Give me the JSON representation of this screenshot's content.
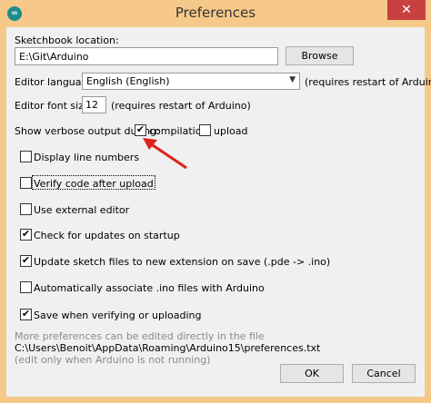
{
  "window": {
    "title": "Preferences",
    "close_glyph": "✕",
    "app_icon_text": "∞"
  },
  "sketchbook": {
    "label": "Sketchbook location:",
    "value": "E:\\Git\\Arduino",
    "browse_label": "Browse"
  },
  "language": {
    "label": "Editor language:",
    "value": "English (English)",
    "note": "(requires restart of Arduino)"
  },
  "font_size": {
    "label": "Editor font size:",
    "value": "12",
    "note": "(requires restart of Arduino)"
  },
  "verbose": {
    "label": "Show verbose output during:",
    "compilation_label": "compilation",
    "compilation_checked": true,
    "upload_label": "upload",
    "upload_checked": false
  },
  "options": [
    {
      "label": "Display line numbers",
      "checked": false
    },
    {
      "label": "Verify code after upload",
      "checked": false
    },
    {
      "label": "Use external editor",
      "checked": false
    },
    {
      "label": "Check for updates on startup",
      "checked": true
    },
    {
      "label": "Update sketch files to new extension on save (.pde -> .ino)",
      "checked": true
    },
    {
      "label": "Automatically associate .ino files with Arduino",
      "checked": false
    },
    {
      "label": "Save when verifying or uploading",
      "checked": true
    }
  ],
  "footer": {
    "more_text": "More preferences can be edited directly in the file",
    "path": "C:\\Users\\Benoit\\AppData\\Roaming\\Arduino15\\preferences.txt",
    "edit_note": "(edit only when Arduino is not running)",
    "ok_label": "OK",
    "cancel_label": "Cancel"
  },
  "colors": {
    "titlebar": "#f6c98a",
    "close_button": "#c94040",
    "arrow": "#e0201a"
  },
  "icons": {
    "check": "✔",
    "dropdown": "▼"
  }
}
